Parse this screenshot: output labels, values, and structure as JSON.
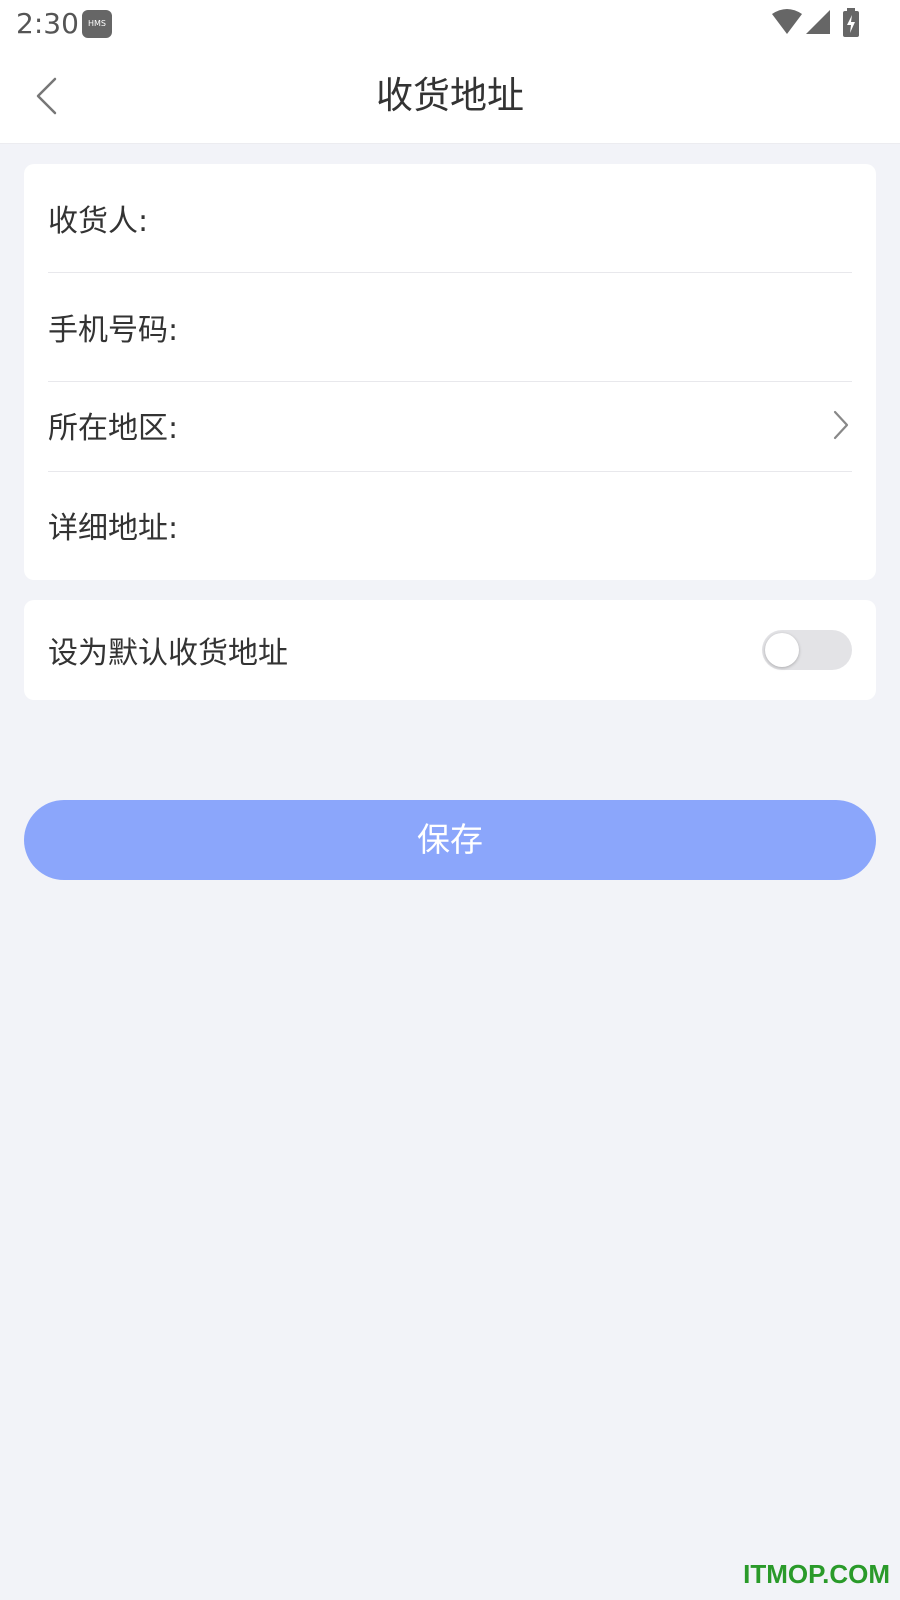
{
  "status_bar": {
    "time": "2:30",
    "badge": "HMS",
    "icons": [
      "wifi-icon",
      "signal-icon",
      "battery-charging-icon"
    ]
  },
  "nav": {
    "title": "收货地址",
    "back_icon": "chevron-left-icon"
  },
  "form": {
    "recipient_label": "收货人:",
    "recipient_value": "",
    "phone_label": "手机号码:",
    "phone_value": "",
    "region_label": "所在地区:",
    "region_value": "",
    "region_icon": "chevron-right-icon",
    "address_label": "详细地址:",
    "address_value": ""
  },
  "default_address": {
    "label": "设为默认收货地址",
    "enabled": false
  },
  "save_button": {
    "label": "保存"
  },
  "watermark": "ITMOP.COM",
  "colors": {
    "background": "#f2f3f8",
    "primary_button": "#8ba6fb",
    "toggle_off": "#e3e3e6",
    "watermark": "#2a9a2a"
  }
}
